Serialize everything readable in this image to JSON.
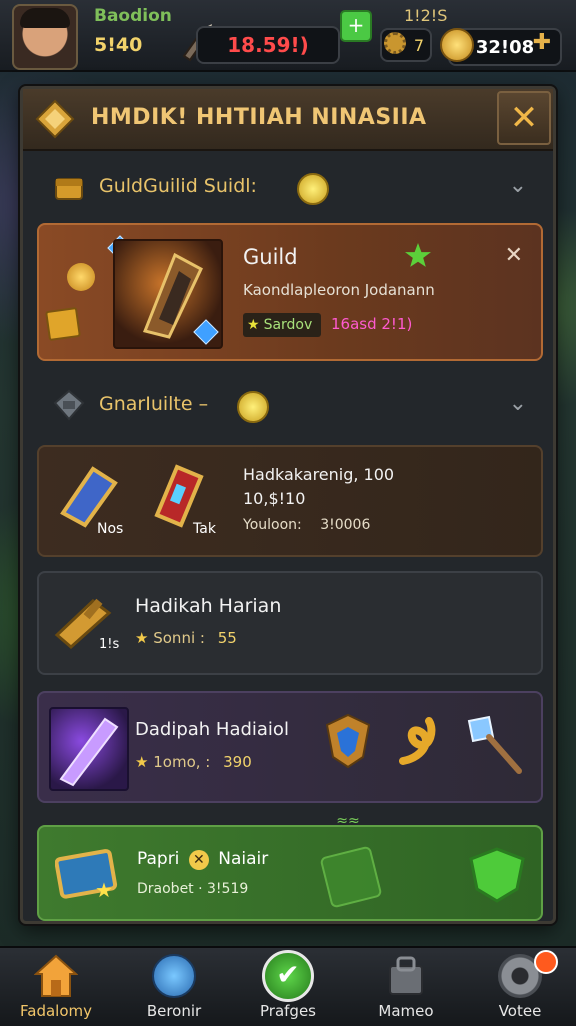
{
  "topbar": {
    "player_name": "Baodion",
    "player_level": "5!40",
    "red_value": "18.59!)",
    "small_value": "1!2!S",
    "gear_value": "7",
    "coins_value": "32!08"
  },
  "panel": {
    "title": "HMDIK! HHTIIAH NINASIIA",
    "close_label": "✕"
  },
  "sections": [
    {
      "title": "GuldGuilid Suidl:",
      "chevron": "⌄"
    },
    {
      "title": "GnarIuilte –",
      "chevron": "⌄"
    }
  ],
  "cards": {
    "guild": {
      "title": "Guild",
      "subtitle": "Kaondlapleoron Jodanann",
      "tag_green": "Sardov",
      "tag_pink": "16asd 2!1)"
    },
    "hadkakarenig": {
      "title": "Hadkakarenig, 100",
      "line2": "10,$!10",
      "line3_label": "Youloon:",
      "line3_value": "3!0006",
      "item1_label": "Nos",
      "item2_label": "Tak"
    },
    "hadikah": {
      "title": "Hadikah Harian",
      "item_label": "1!s",
      "stat_label": "Sonni :",
      "stat_value": "55"
    },
    "dadipah": {
      "title": "Dadipah Hadiaiol",
      "stat_label": "1omo, :",
      "stat_value": "390"
    },
    "papri": {
      "title": "Papri",
      "title2": "Naiair",
      "line2": "Draobet · 3!519"
    }
  },
  "nav": [
    {
      "label": "Fadalomy",
      "icon": "home-icon"
    },
    {
      "label": "Beronir",
      "icon": "search-creature-icon"
    },
    {
      "label": "Prafges",
      "icon": "check-icon"
    },
    {
      "label": "Mameo",
      "icon": "shop-icon"
    },
    {
      "label": "Votee",
      "icon": "settings-icon"
    }
  ],
  "colors": {
    "accent": "#f0c674",
    "green": "#4bc944",
    "orange_card": "#8a4a25"
  }
}
